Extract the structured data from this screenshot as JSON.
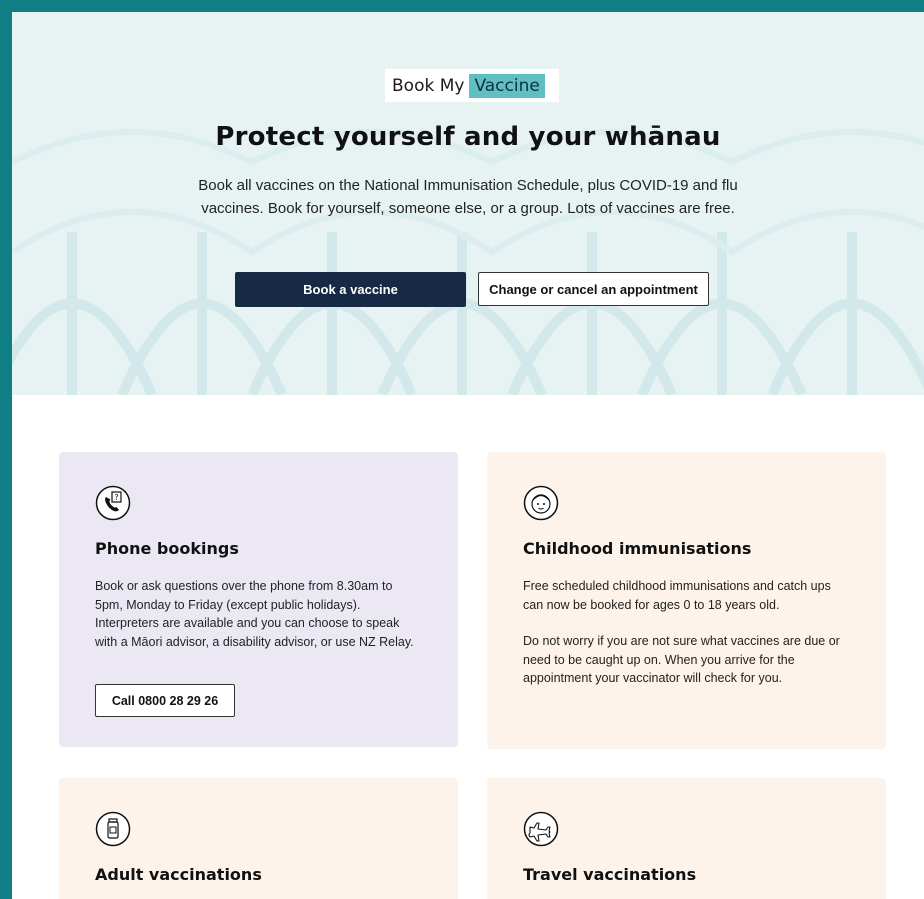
{
  "colors": {
    "frame": "#0f7f85",
    "primary_button": "#172a45",
    "logo_highlight": "#5fbfc3"
  },
  "logo": {
    "text": "Book My",
    "highlight": "Vaccine"
  },
  "hero": {
    "title": "Protect yourself and your whānau",
    "description": "Book all vaccines on the National Immunisation Schedule, plus COVID-19 and flu vaccines. Book for yourself, someone else, or a group. Lots of vaccines are free.",
    "primary_button": "Book a vaccine",
    "secondary_button": "Change or cancel an appointment"
  },
  "cards": {
    "phone": {
      "icon": "phone-question-icon",
      "title": "Phone bookings",
      "body": "Book or ask questions over the phone from 8.30am to 5pm, Monday to Friday (except public holidays). Interpreters are available and you can choose to speak with a Māori advisor, a disability advisor, or use NZ Relay.",
      "button": "Call 0800 28 29 26"
    },
    "childhood": {
      "icon": "child-face-icon",
      "title": "Childhood immunisations",
      "body1": "Free scheduled childhood immunisations and catch ups can now be booked for ages 0 to 18 years old.",
      "body2": "Do not worry if you are not sure what vaccines are due or need to be caught up on. When you arrive for the appointment your vaccinator will check for you."
    },
    "adult": {
      "icon": "vaccine-vial-icon",
      "title": "Adult vaccinations"
    },
    "travel": {
      "icon": "airplane-icon",
      "title": "Travel vaccinations"
    }
  }
}
